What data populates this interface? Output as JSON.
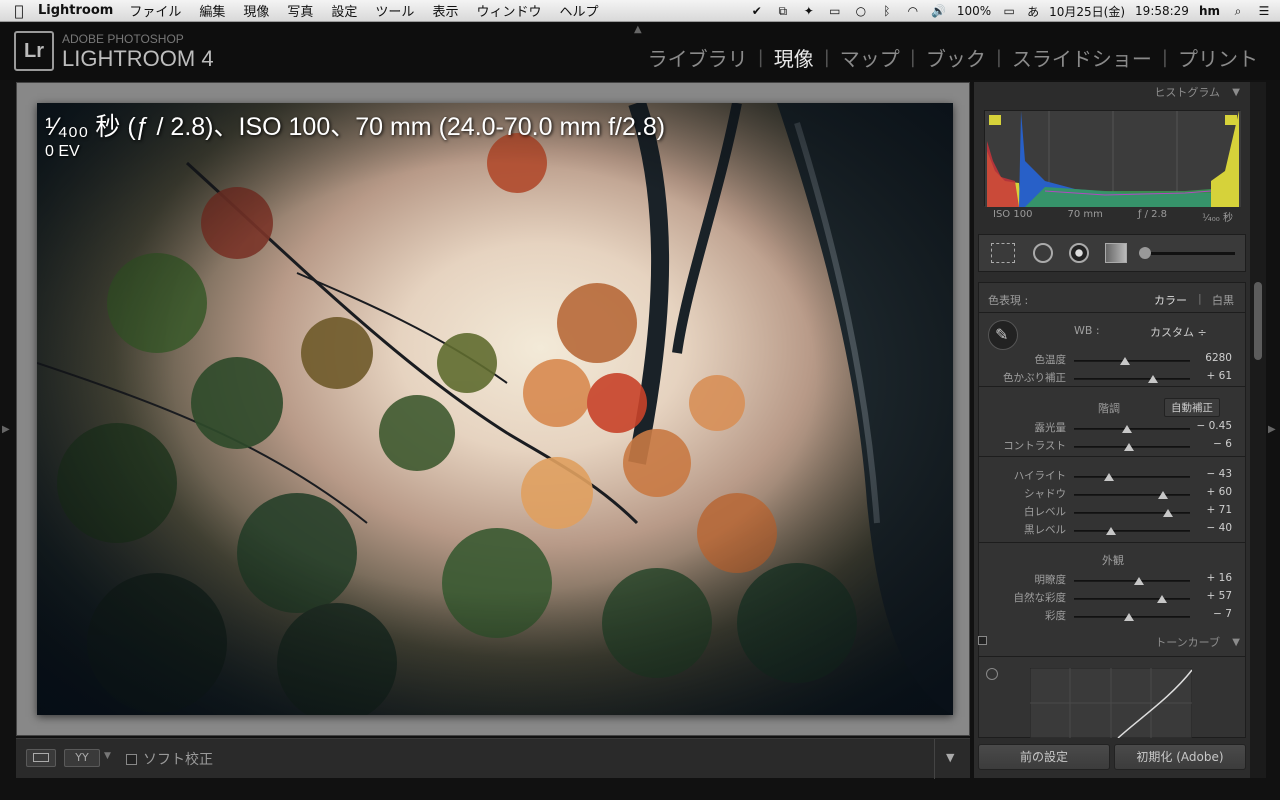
{
  "menubar": {
    "app": "Lightroom",
    "items": [
      "ファイル",
      "編集",
      "現像",
      "写真",
      "設定",
      "ツール",
      "表示",
      "ウィンドウ",
      "ヘルプ"
    ],
    "battery": "100%",
    "input_method": "あ",
    "date": "10月25日(金)",
    "time": "19:58:29",
    "user": "hm"
  },
  "header": {
    "subtitle": "ADOBE PHOTOSHOP",
    "title": "LIGHTROOM 4",
    "logo": "Lr",
    "modules": [
      "ライブラリ",
      "現像",
      "マップ",
      "ブック",
      "スライドショー",
      "プリント"
    ],
    "active_module": "現像"
  },
  "photo": {
    "info": "¹⁄₄₀₀ 秒 (ƒ / 2.8)、ISO 100、70 mm (24.0-70.0 mm f/2.8)",
    "ev": "0 EV"
  },
  "toolbar": {
    "soft_proof": "ソフト校正",
    "yy": "YY"
  },
  "panel": {
    "histogram_title": "ヒストグラム",
    "hist_meta": [
      "ISO 100",
      "70 mm",
      "ƒ / 2.8",
      "¹⁄₄₀₀ 秒"
    ],
    "treatment_label": "色表現 :",
    "treatment_color": "カラー",
    "treatment_bw": "白黒",
    "wb_label": "WB :",
    "wb_value": "カスタム ÷",
    "tone_title": "階調",
    "auto_tone": "自動補正",
    "presence_title": "外観",
    "tone_curve_title": "トーンカーブ",
    "prev_button": "前の設定",
    "reset_button": "初期化 (Adobe)",
    "sliders": {
      "temp": {
        "label": "色温度",
        "value": "6280",
        "pos": 0.44
      },
      "tint": {
        "label": "色かぶり補正",
        "value": "+ 61",
        "pos": 0.68
      },
      "exposure": {
        "label": "露光量",
        "value": "− 0.45",
        "pos": 0.46
      },
      "contrast": {
        "label": "コントラスト",
        "value": "− 6",
        "pos": 0.47
      },
      "highlights": {
        "label": "ハイライト",
        "value": "− 43",
        "pos": 0.3
      },
      "shadows": {
        "label": "シャドウ",
        "value": "+ 60",
        "pos": 0.77
      },
      "whites": {
        "label": "白レベル",
        "value": "+ 71",
        "pos": 0.81
      },
      "blacks": {
        "label": "黒レベル",
        "value": "− 40",
        "pos": 0.32
      },
      "clarity": {
        "label": "明瞭度",
        "value": "+ 16",
        "pos": 0.56
      },
      "vibrance": {
        "label": "自然な彩度",
        "value": "+ 57",
        "pos": 0.76
      },
      "saturation": {
        "label": "彩度",
        "value": "− 7",
        "pos": 0.47
      }
    }
  }
}
